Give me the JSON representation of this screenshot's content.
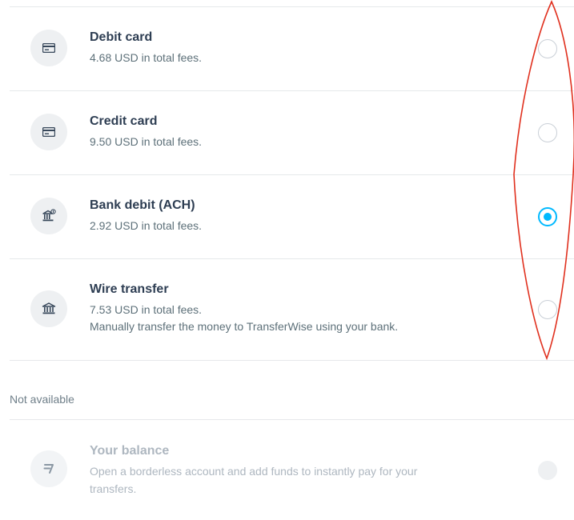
{
  "options": [
    {
      "title": "Debit card",
      "fee": "4.68 USD in total fees.",
      "icon": "card-icon",
      "selected": false
    },
    {
      "title": "Credit card",
      "fee": "9.50 USD in total fees.",
      "icon": "card-icon",
      "selected": false
    },
    {
      "title": "Bank debit (ACH)",
      "fee": "2.92 USD in total fees.",
      "icon": "bank-debit-icon",
      "selected": true
    },
    {
      "title": "Wire transfer",
      "fee": "7.53 USD in total fees.",
      "note": "Manually transfer the money to TransferWise using your bank.",
      "icon": "bank-icon",
      "selected": false
    }
  ],
  "unavailable": {
    "section_label": "Not available",
    "balance": {
      "title": "Your balance",
      "line1": "Open a borderless account and add funds to instantly pay for your",
      "line2": "transfers.",
      "icon": "transferwise-logo-icon"
    }
  },
  "colors": {
    "accent": "#00b9ff",
    "annotation": "#e0301e",
    "title": "#2e3e53",
    "subtext": "#5d7079"
  }
}
